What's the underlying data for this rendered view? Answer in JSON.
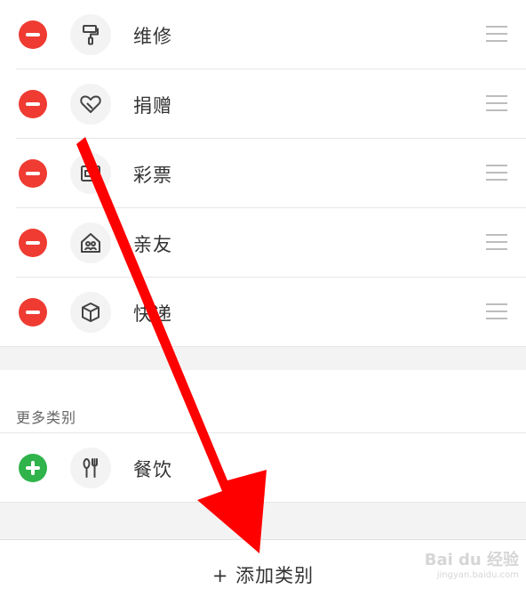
{
  "categories": [
    {
      "label": "维修",
      "icon": "paint-roller-icon"
    },
    {
      "label": "捐赠",
      "icon": "heart-icon"
    },
    {
      "label": "彩票",
      "icon": "lottery-ticket-icon"
    },
    {
      "label": "亲友",
      "icon": "family-house-icon"
    },
    {
      "label": "快递",
      "icon": "package-box-icon"
    }
  ],
  "more_section": {
    "title": "更多类别",
    "items": [
      {
        "label": "餐饮",
        "icon": "fork-knife-icon"
      }
    ]
  },
  "footer": {
    "add_label": "+ 添加类别"
  },
  "watermark": {
    "brand": "Bai du 经验",
    "site": "jingyan.baidu.com"
  },
  "colors": {
    "remove": "#ef3b32",
    "add": "#2fb34a",
    "annotation_arrow": "#ff0000"
  }
}
